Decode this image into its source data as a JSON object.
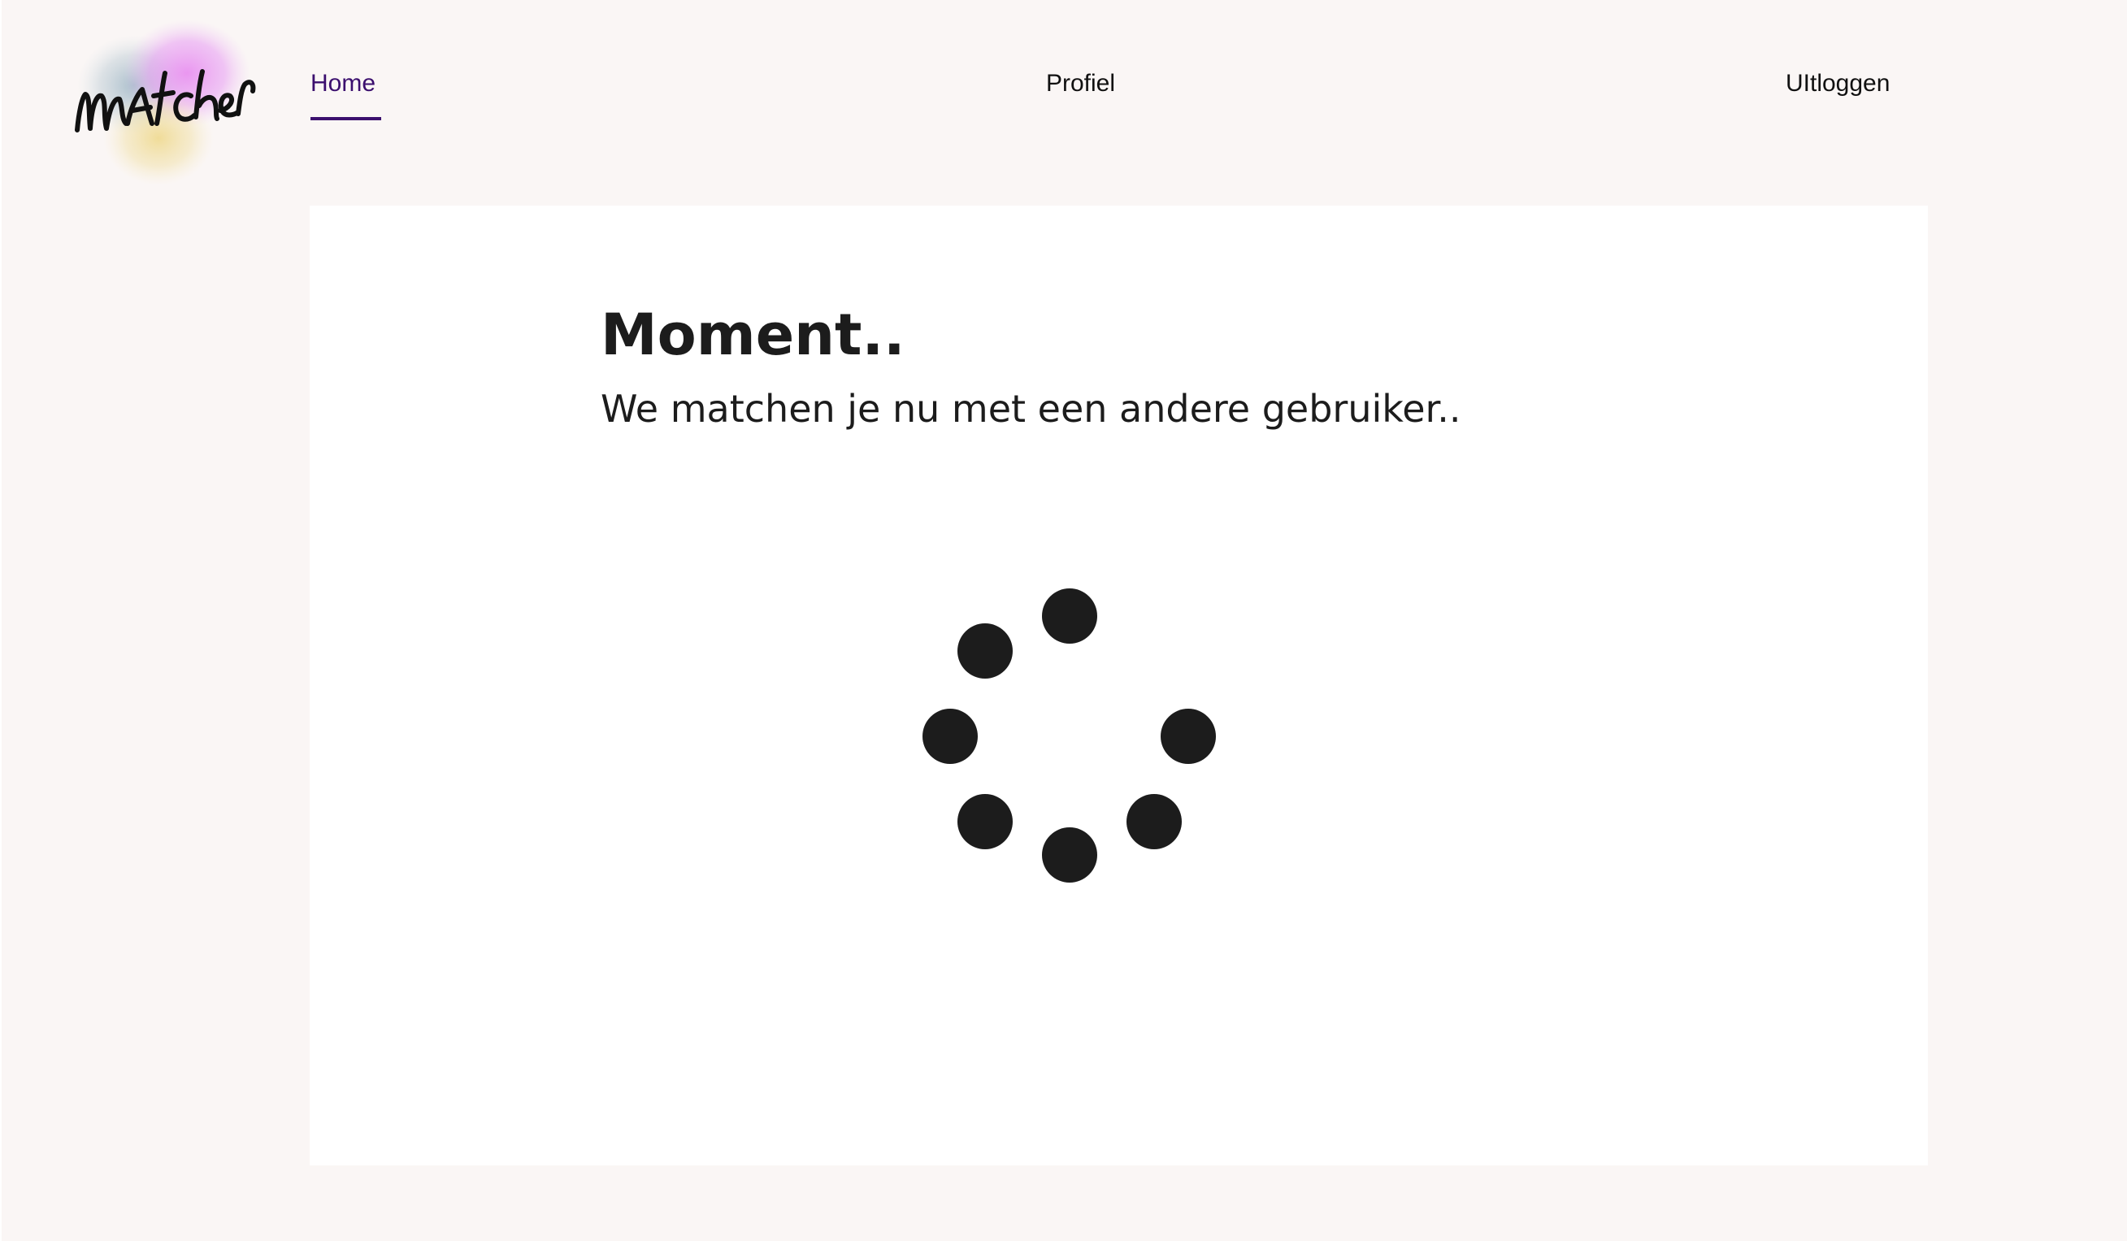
{
  "app": {
    "logo_text": "matcher",
    "accent_color": "#3b0f6e"
  },
  "nav": {
    "home_label": "Home",
    "profile_label": "Profiel",
    "logout_label": "UItloggen",
    "active": "Home"
  },
  "main": {
    "title": "Moment..",
    "subtitle": "We matchen je nu met een andere gebruiker..",
    "loading_indicator": "dot-spinner"
  }
}
